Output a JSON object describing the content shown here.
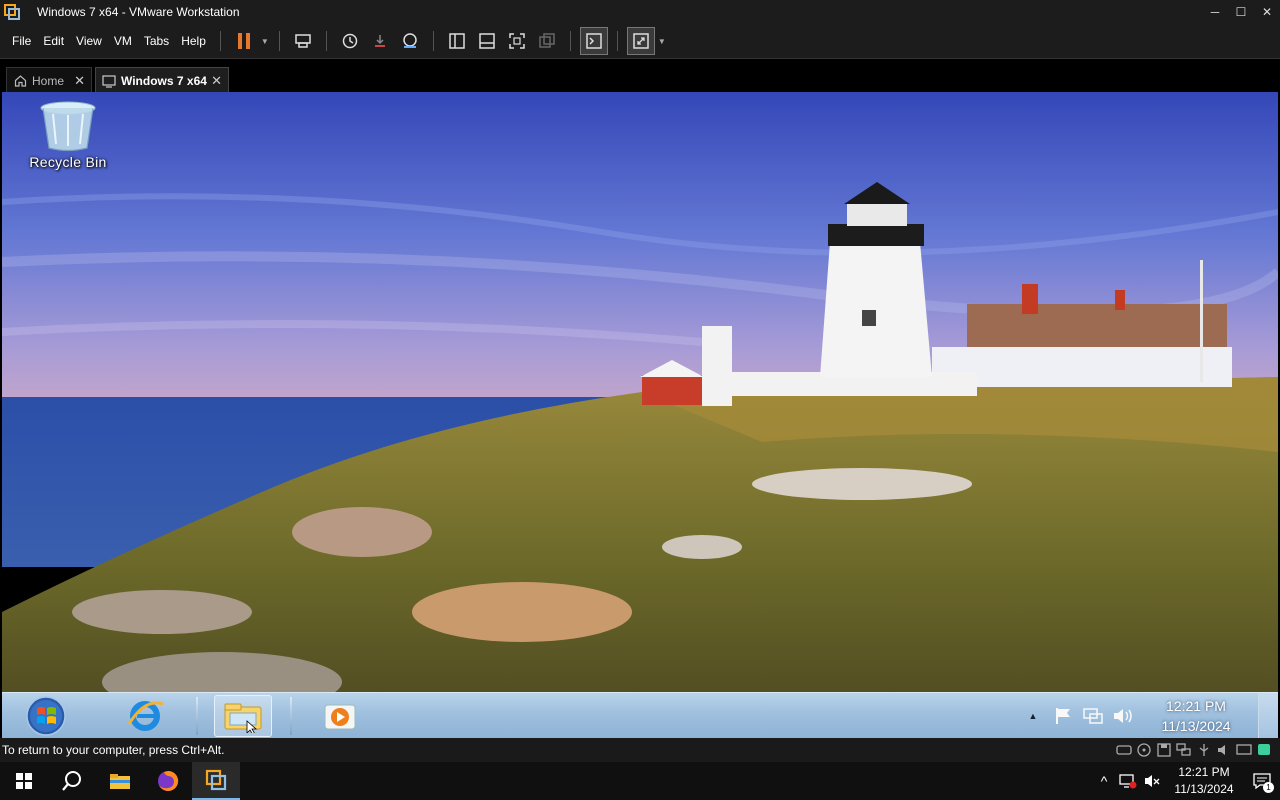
{
  "window": {
    "title": "Windows 7 x64 - VMware Workstation",
    "minimize": "─",
    "maximize": "☐",
    "close": "✕"
  },
  "menu": {
    "items": [
      "File",
      "Edit",
      "View",
      "VM",
      "Tabs",
      "Help"
    ]
  },
  "tabs": {
    "home_label": "Home",
    "vm_label": "Windows 7 x64",
    "close": "✕"
  },
  "guest": {
    "desktop_icons": [
      {
        "label": "Recycle Bin",
        "icon": "recycle-bin-icon"
      }
    ],
    "taskbar": {
      "pinned": [
        "internet-explorer-icon",
        "windows-explorer-icon",
        "media-player-icon"
      ],
      "tray_expand": "▲",
      "clock_time": "12:21 PM",
      "clock_date": "11/13/2024"
    }
  },
  "status": {
    "message": "To return to your computer, press Ctrl+Alt."
  },
  "host": {
    "taskbar": {
      "apps": [
        "search-icon",
        "file-explorer-icon",
        "firefox-icon",
        "vmware-icon"
      ],
      "tray_expand": "^",
      "clock_time": "12:21 PM",
      "clock_date": "11/13/2024",
      "notification_count": "1"
    }
  },
  "colors": {
    "vmware_chrome": "#1c1c1c",
    "pause_orange": "#e8772e",
    "win7_taskbar": "#9fc0de",
    "host_accent": "#76b9ed"
  }
}
